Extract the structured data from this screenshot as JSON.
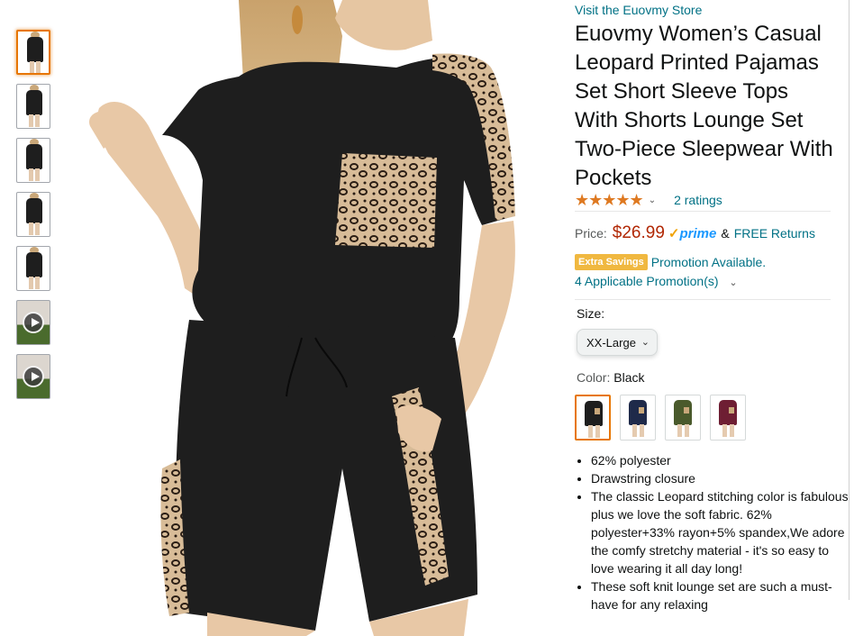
{
  "store_link": "Visit the Euovmy Store",
  "title": "Euovmy Women’s Casual Leopard Printed Pajamas Set Short Sleeve Tops With Shorts Lounge Set Two-Piece Sleepwear With Pockets",
  "rating": {
    "stars": "★★★★★",
    "count_text": "2 ratings",
    "chevron": "⌄"
  },
  "price": {
    "label": "Price:",
    "value": "$26.99",
    "prime": "prime",
    "prime_check": "✓",
    "amp": "&",
    "free_returns": "FREE Returns"
  },
  "promotion": {
    "badge": "Extra Savings",
    "text": "Promotion Available.",
    "applicable": "4 Applicable Promotion(s)",
    "chevron": "⌄"
  },
  "size": {
    "label": "Size:",
    "selected": "XX-Large",
    "dropdown_icon": "⌄"
  },
  "color": {
    "label": "Color:",
    "selected": "Black",
    "swatches": [
      {
        "name": "black",
        "color": "#1e1e1e"
      },
      {
        "name": "navy",
        "color": "#1f2a4a"
      },
      {
        "name": "army-green",
        "color": "#4a5a2c"
      },
      {
        "name": "wine-red",
        "color": "#6e1e33"
      }
    ]
  },
  "bullets": [
    "62% polyester",
    "Drawstring closure",
    "The classic Leopard stitching color is fabulous, plus we love the soft fabric. 62% polyester+33% rayon+5% spandex,We adore the comfy stretchy material - it's so easy to love wearing it all day long!",
    "These soft knit lounge set are such a must-have for any relaxing"
  ],
  "thumbnails": [
    {
      "type": "image",
      "selected": true
    },
    {
      "type": "image",
      "selected": false
    },
    {
      "type": "image",
      "selected": false
    },
    {
      "type": "image",
      "selected": false
    },
    {
      "type": "image",
      "selected": false
    },
    {
      "type": "video",
      "selected": false
    },
    {
      "type": "video",
      "selected": false
    }
  ],
  "colors": {
    "link": "#007185",
    "price": "#b12704",
    "star": "#de7921",
    "selected_border": "#e77600",
    "badge": "#f0b840",
    "garment": "#1e1e1e"
  }
}
